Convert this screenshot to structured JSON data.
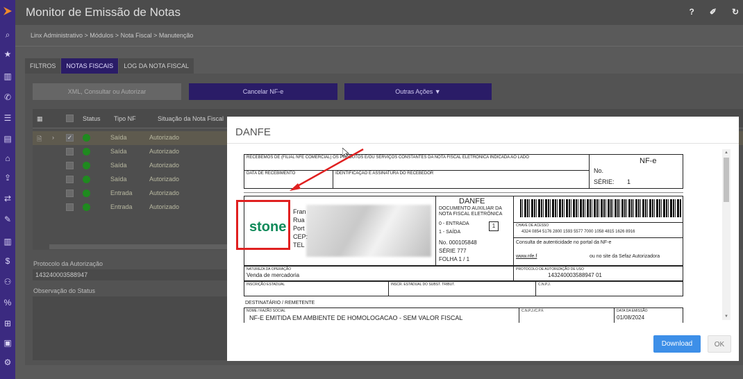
{
  "app": {
    "title": "Monitor de Emissão de Notas",
    "breadcrumb": "Linx Administrativo  >  Módulos  >  Nota Fiscal  >  Manutenção",
    "top_icons": [
      "help-icon",
      "eraser-icon",
      "refresh-icon"
    ],
    "help_glyph": "?"
  },
  "tabs": [
    "FILTROS",
    "NOTAS FISCAIS",
    "LOG DA NOTA FISCAL"
  ],
  "toolbar": {
    "xml_placeholder": "XML, Consultar ou Autorizar",
    "cancel_label": "Cancelar NF-e",
    "other_label": "Outras Ações ▼"
  },
  "grid": {
    "headers": [
      "Status",
      "Tipo NF",
      "Situação da Nota Fiscal"
    ],
    "rows": [
      {
        "tipo": "Saída",
        "situacao": "Autorizado"
      },
      {
        "tipo": "Saída",
        "situacao": "Autorizado"
      },
      {
        "tipo": "Saída",
        "situacao": "Autorizado"
      },
      {
        "tipo": "Saída",
        "situacao": "Autorizado"
      },
      {
        "tipo": "Entrada",
        "situacao": "Autorizado"
      },
      {
        "tipo": "Entrada",
        "situacao": "Autorizado"
      }
    ]
  },
  "details": {
    "protocolo_label": "Protocolo da Autorização",
    "protocolo_value": "143240003588947",
    "observacao_label": "Observação do Status"
  },
  "modal": {
    "title": "DANFE",
    "download_label": "Download",
    "ok_label": "OK"
  },
  "danfe": {
    "canhoto_text": "RECEBEMOS DE (FILIAL NFE COMERCIAL) OS PRODUTOS E/OU SERVIÇOS CONSTANTES DA NOTA FISCAL ELETRÔNICA INDICADA AO LADO",
    "data_recebimento": "DATA DE RECEBIMENTO",
    "identificacao": "IDENTIFICAÇÃO E ASSINATURA DO RECEBEDOR",
    "nfe_label": "NF-e",
    "no_label": "No.",
    "serie_label": "SÉRIE:",
    "serie_value": "1",
    "issuer_lines": [
      "Fran",
      "Rua",
      "Port",
      "CEP:",
      "TEL"
    ],
    "logo_text": "stone",
    "danfe_title": "DANFE",
    "danfe_sub1": "DOCUMENTO AUXILIAR DA",
    "danfe_sub2": "NOTA FISCAL ELETRÔNICA",
    "entrada": "0 - ENTRADA",
    "saida": "1 - SAÍDA",
    "tipo_value": "1",
    "numero": "No.  000105848",
    "serie_line": "SÉRIE     777",
    "folha": "FOLHA    1 / 1",
    "chave_label": "CHAVE DE ACESSO",
    "chave_value": "4324 0854 5176 2800 1593 5577 7000 1058 4815 1626 8916",
    "consulta": "Consulta de autenticidade no portal da NF-e",
    "consulta_link": "www.nfe.f",
    "consulta_tail": "ou no site da Sefaz Autorizadora",
    "natureza_label": "NATUREZA DA OPERAÇÃO",
    "natureza_value": "Venda de mercadoria",
    "protocolo_label": "PROTOCOLO DE AUTORIZAÇÃO DE USO",
    "protocolo_value": "143240003588947 01",
    "ie_label": "INSCRIÇÃO ESTADUAL",
    "ie_st_label": "INSCR. ESTADUAL DO SUBST. TRIBUT.",
    "cnpj_label": "C.N.P.J.",
    "dest_title": "DESTINATÁRIO / REMETENTE",
    "razao_label": "NOME / RAZÃO SOCIAL",
    "razao_value": "NF-E EMITIDA EM AMBIENTE DE HOMOLOGACAO - SEM VALOR FISCAL",
    "cnpj_cpf_label": "C.N.P.J./C.P.F.",
    "data_emissao_label": "DATA DA EMISSÃO",
    "data_emissao_value": "01/08/2024"
  }
}
